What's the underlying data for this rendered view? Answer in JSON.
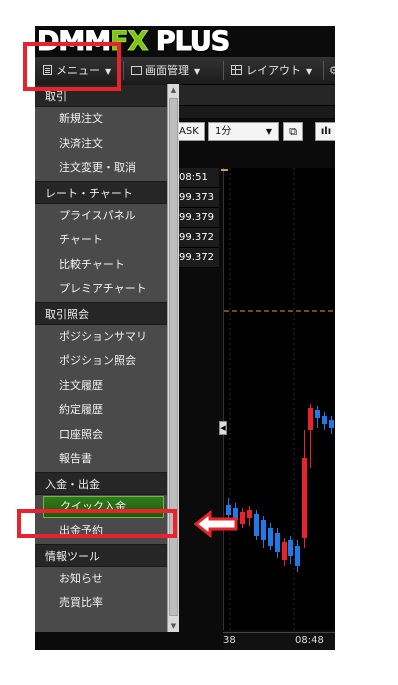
{
  "app": {
    "logo_left": "DMM",
    "logo_fx": "FX",
    "logo_right": "PLUS"
  },
  "toolbar": {
    "menu_label": "メニュー",
    "screen_label": "画面管理",
    "layout_label": "レイアウト",
    "caret": "▼"
  },
  "chart_controls": {
    "side": "ASK",
    "timeframe": "1分"
  },
  "prices": [
    "08:51",
    "99.373",
    "99.379",
    "99.372",
    "99.372"
  ],
  "chart_time_labels": [
    "38",
    "08:48"
  ],
  "menu": {
    "sections": [
      {
        "title": "取引",
        "items": [
          "新規注文",
          "決済注文",
          "注文変更・取消"
        ]
      },
      {
        "title": "レート・チャート",
        "items": [
          "プライスパネル",
          "チャート",
          "比較チャート",
          "プレミアチャート"
        ]
      },
      {
        "title": "取引照会",
        "items": [
          "ポジションサマリ",
          "ポジション照会",
          "注文履歴",
          "約定履歴",
          "口座照会",
          "報告書"
        ]
      },
      {
        "title": "入金・出金",
        "items": [
          "クイック入金",
          "出金予約"
        ]
      },
      {
        "title": "情報ツール",
        "items": [
          "お知らせ",
          "売買比率"
        ]
      }
    ],
    "active_item": "クイック入金"
  },
  "colors": {
    "highlight": "#e8232b",
    "active_item": "#2a6e16",
    "candle_up": "#e8232b",
    "candle_down": "#1e7be6"
  }
}
